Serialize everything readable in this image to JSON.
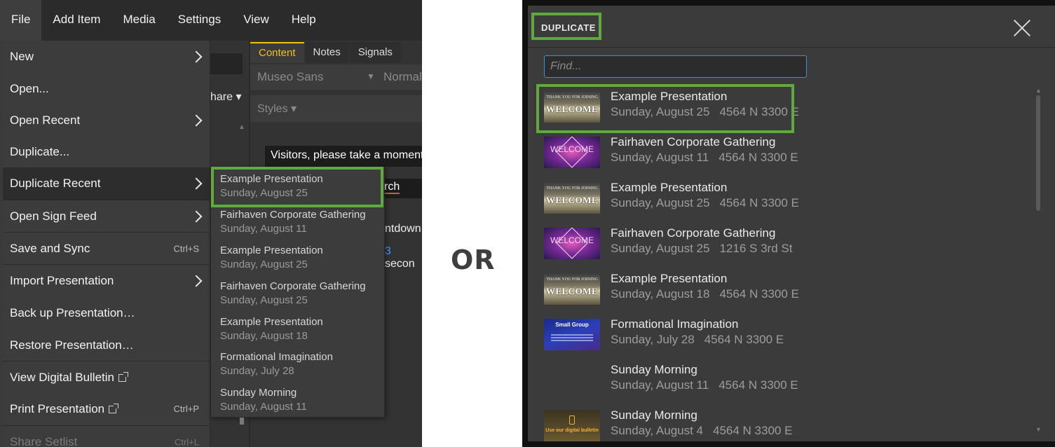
{
  "menubar": {
    "items": [
      {
        "label": "File"
      },
      {
        "label": "Add Item"
      },
      {
        "label": "Media"
      },
      {
        "label": "Settings"
      },
      {
        "label": "View"
      },
      {
        "label": "Help"
      }
    ]
  },
  "editor": {
    "share_label": "hare ▾",
    "tabs": [
      {
        "label": "Content"
      },
      {
        "label": "Notes"
      },
      {
        "label": "Signals"
      }
    ],
    "font_name": "Museo Sans",
    "font_weight": "Normal",
    "styles_label": "Styles ▾",
    "visitors_text": "Visitors, please take a moment",
    "church_fragment": "rch",
    "countdown_fragment": "ntdown",
    "seconds_number": "3",
    "seconds_text": " secon"
  },
  "file_menu": {
    "items": [
      {
        "label": "New"
      },
      {
        "label": "Open..."
      },
      {
        "label": "Open Recent"
      },
      {
        "label": "Duplicate..."
      },
      {
        "label": "Duplicate Recent"
      },
      {
        "label": "Open Sign Feed"
      },
      {
        "label": "Save and Sync",
        "shortcut": "Ctrl+S"
      },
      {
        "label": "Import Presentation"
      },
      {
        "label": "Back up Presentation…"
      },
      {
        "label": "Restore Presentation…"
      },
      {
        "label": "View Digital Bulletin"
      },
      {
        "label": "Print Presentation",
        "shortcut": "Ctrl+P"
      },
      {
        "label": "Share Setlist",
        "shortcut": "Ctrl+L"
      }
    ]
  },
  "duplicate_recent": {
    "items": [
      {
        "title": "Example Presentation",
        "date": "Sunday, August 25"
      },
      {
        "title": "Fairhaven Corporate Gathering",
        "date": "Sunday, August 11"
      },
      {
        "title": "Example Presentation",
        "date": "Sunday, August 25"
      },
      {
        "title": "Fairhaven Corporate Gathering",
        "date": "Sunday, August 25"
      },
      {
        "title": "Example Presentation",
        "date": "Sunday, August 18"
      },
      {
        "title": "Formational Imagination",
        "date": "Sunday, July 28"
      },
      {
        "title": "Sunday Morning",
        "date": "Sunday, August 11"
      }
    ]
  },
  "separator_label": "OR",
  "duplicate_dialog": {
    "title": "DUPLICATE",
    "find_placeholder": "Find...",
    "items": [
      {
        "title": "Example Presentation",
        "date": "Sunday, August 25",
        "address": "4564 N 3300 E",
        "thumb": "welcome"
      },
      {
        "title": "Fairhaven Corporate Gathering",
        "date": "Sunday, August 11",
        "address": "4564 N 3300 E",
        "thumb": "gathering"
      },
      {
        "title": "Example Presentation",
        "date": "Sunday, August 25",
        "address": "4564 N 3300 E",
        "thumb": "welcome"
      },
      {
        "title": "Fairhaven Corporate Gathering",
        "date": "Sunday, August 25",
        "address": "1216 S 3rd St",
        "thumb": "gathering"
      },
      {
        "title": "Example Presentation",
        "date": "Sunday, August 18",
        "address": "4564 N 3300 E",
        "thumb": "welcome"
      },
      {
        "title": "Formational Imagination",
        "date": "Sunday, July 28",
        "address": "4564 N 3300 E",
        "thumb": "smallgroup"
      },
      {
        "title": "Sunday Morning",
        "date": "Sunday, August 11",
        "address": "4564 N 3300 E",
        "thumb": "blank"
      },
      {
        "title": "Sunday Morning",
        "date": "Sunday, August 4",
        "address": "4564 N 3300 E",
        "thumb": "bulletin"
      }
    ],
    "thumb_text": {
      "welcome": "WELCOME",
      "welcome_sub": "THANK YOU FOR JOINING",
      "gathering": "WELCOME",
      "smallgroup": "Small Group",
      "bulletin": "Use our digital bulletin"
    }
  },
  "colors": {
    "highlight_green": "#5fa93e",
    "active_tab": "#f0c21b",
    "input_focus": "#3d8fdc"
  },
  "icons": [
    "chevron-right-icon",
    "external-link-icon",
    "close-icon"
  ]
}
